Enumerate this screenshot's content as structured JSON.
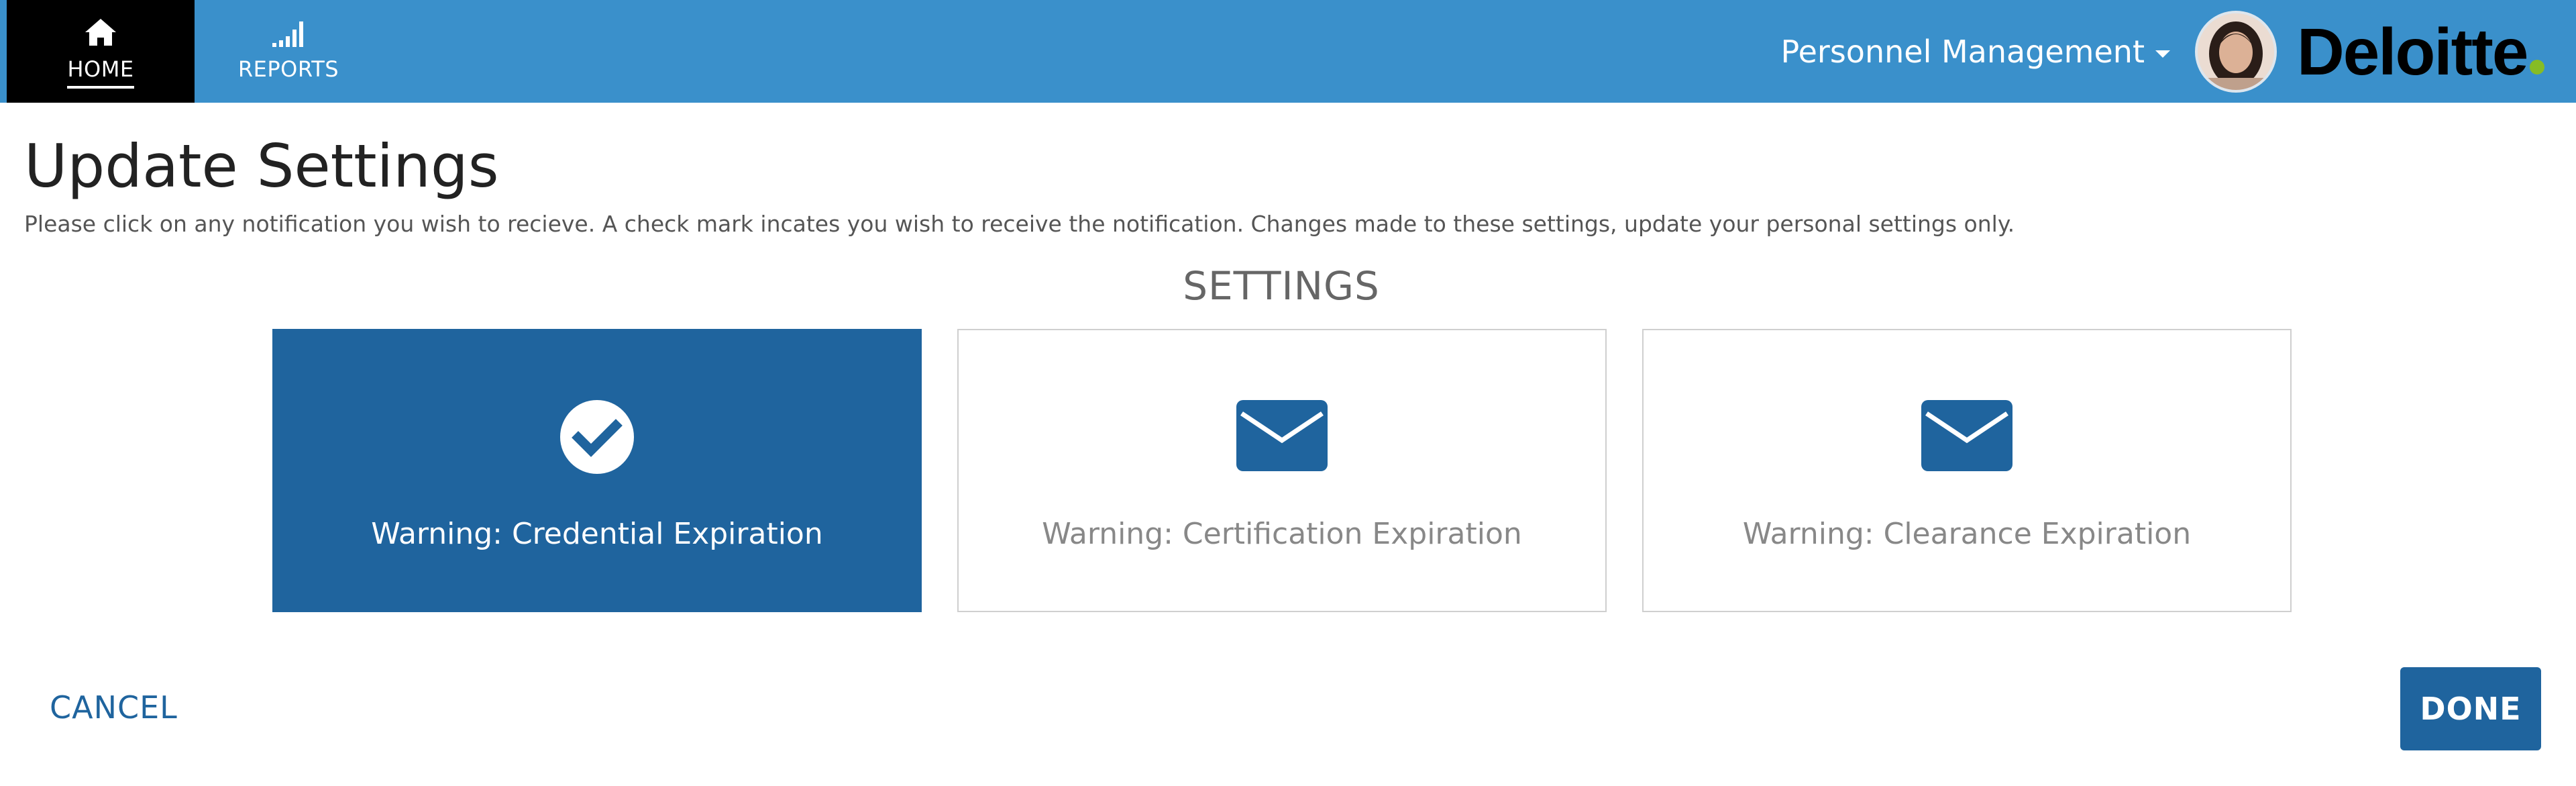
{
  "nav": {
    "items": [
      {
        "label": "HOME",
        "icon": "home-icon",
        "active": true
      },
      {
        "label": "REPORTS",
        "icon": "signal-bars-icon",
        "active": false
      }
    ]
  },
  "header": {
    "module": "Personnel Management",
    "logo": "Deloitte",
    "logo_dot_color": "#86bc25",
    "bar_color": "#3a90cb"
  },
  "page": {
    "title": "Update Settings",
    "instructions": "Please click on any notification you wish to recieve. A check mark incates you wish to receive the notification. Changes made to these settings, update your personal settings only.",
    "section_heading": "SETTINGS"
  },
  "settings": [
    {
      "label": "Warning: Credential Expiration",
      "selected": true,
      "icon": "check-circle-icon"
    },
    {
      "label": "Warning: Certification Expiration",
      "selected": false,
      "icon": "envelope-icon"
    },
    {
      "label": "Warning: Clearance Expiration",
      "selected": false,
      "icon": "envelope-icon"
    }
  ],
  "actions": {
    "cancel": "CANCEL",
    "done": "DONE"
  },
  "colors": {
    "accent": "#1f649e",
    "nav_active_bg": "#000000"
  }
}
